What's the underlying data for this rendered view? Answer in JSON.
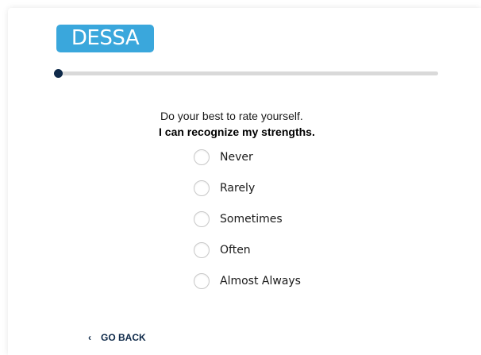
{
  "logo": {
    "text": "DESSA"
  },
  "progress": {
    "value": 0
  },
  "instruction": "Do your best to rate yourself.",
  "question": "I can recognize my strengths.",
  "options": [
    {
      "label": "Never"
    },
    {
      "label": "Rarely"
    },
    {
      "label": "Sometimes"
    },
    {
      "label": "Often"
    },
    {
      "label": "Almost Always"
    }
  ],
  "go_back": {
    "icon": "chevron-left-icon",
    "label": "GO BACK"
  },
  "colors": {
    "brand": "#3aa7dc",
    "navy": "#0f2a4a",
    "track": "#d9d9d9"
  }
}
